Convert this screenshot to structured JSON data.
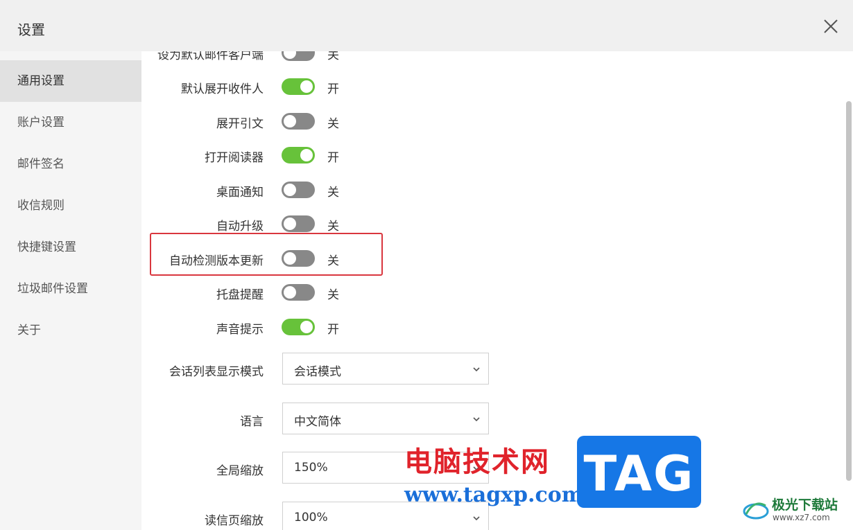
{
  "window": {
    "title": "设置"
  },
  "sidebar": {
    "items": [
      {
        "label": "通用设置",
        "active": true
      },
      {
        "label": "账户设置"
      },
      {
        "label": "邮件签名"
      },
      {
        "label": "收信规则"
      },
      {
        "label": "快捷键设置"
      },
      {
        "label": "垃圾邮件设置"
      },
      {
        "label": "关于"
      }
    ]
  },
  "settings": {
    "toggles": [
      {
        "label": "设为默认邮件客户端",
        "on": false,
        "state_text": "关"
      },
      {
        "label": "默认展开收件人",
        "on": true,
        "state_text": "开"
      },
      {
        "label": "展开引文",
        "on": false,
        "state_text": "关"
      },
      {
        "label": "打开阅读器",
        "on": true,
        "state_text": "开"
      },
      {
        "label": "桌面通知",
        "on": false,
        "state_text": "关"
      },
      {
        "label": "自动升级",
        "on": false,
        "state_text": "关"
      },
      {
        "label": "自动检测版本更新",
        "on": false,
        "state_text": "关"
      },
      {
        "label": "托盘提醒",
        "on": false,
        "state_text": "关"
      },
      {
        "label": "声音提示",
        "on": true,
        "state_text": "开"
      }
    ],
    "selects": [
      {
        "label": "会话列表显示模式",
        "value": "会话模式"
      },
      {
        "label": "语言",
        "value": "中文简体"
      },
      {
        "label": "全局缩放",
        "value": "150%"
      },
      {
        "label": "读信页缩放",
        "value": "100%"
      }
    ]
  },
  "watermark": {
    "site_text": "电脑技术网",
    "url": "www.tagxp.com",
    "badge": "TAG",
    "corner_name": "极光下载站",
    "corner_url": "www.xz7.com"
  },
  "colors": {
    "toggle_on": "#67c23a",
    "toggle_off": "#888888",
    "highlight": "#d9363e",
    "watermark_red": "#e0232b",
    "watermark_blue": "#1677e6"
  }
}
